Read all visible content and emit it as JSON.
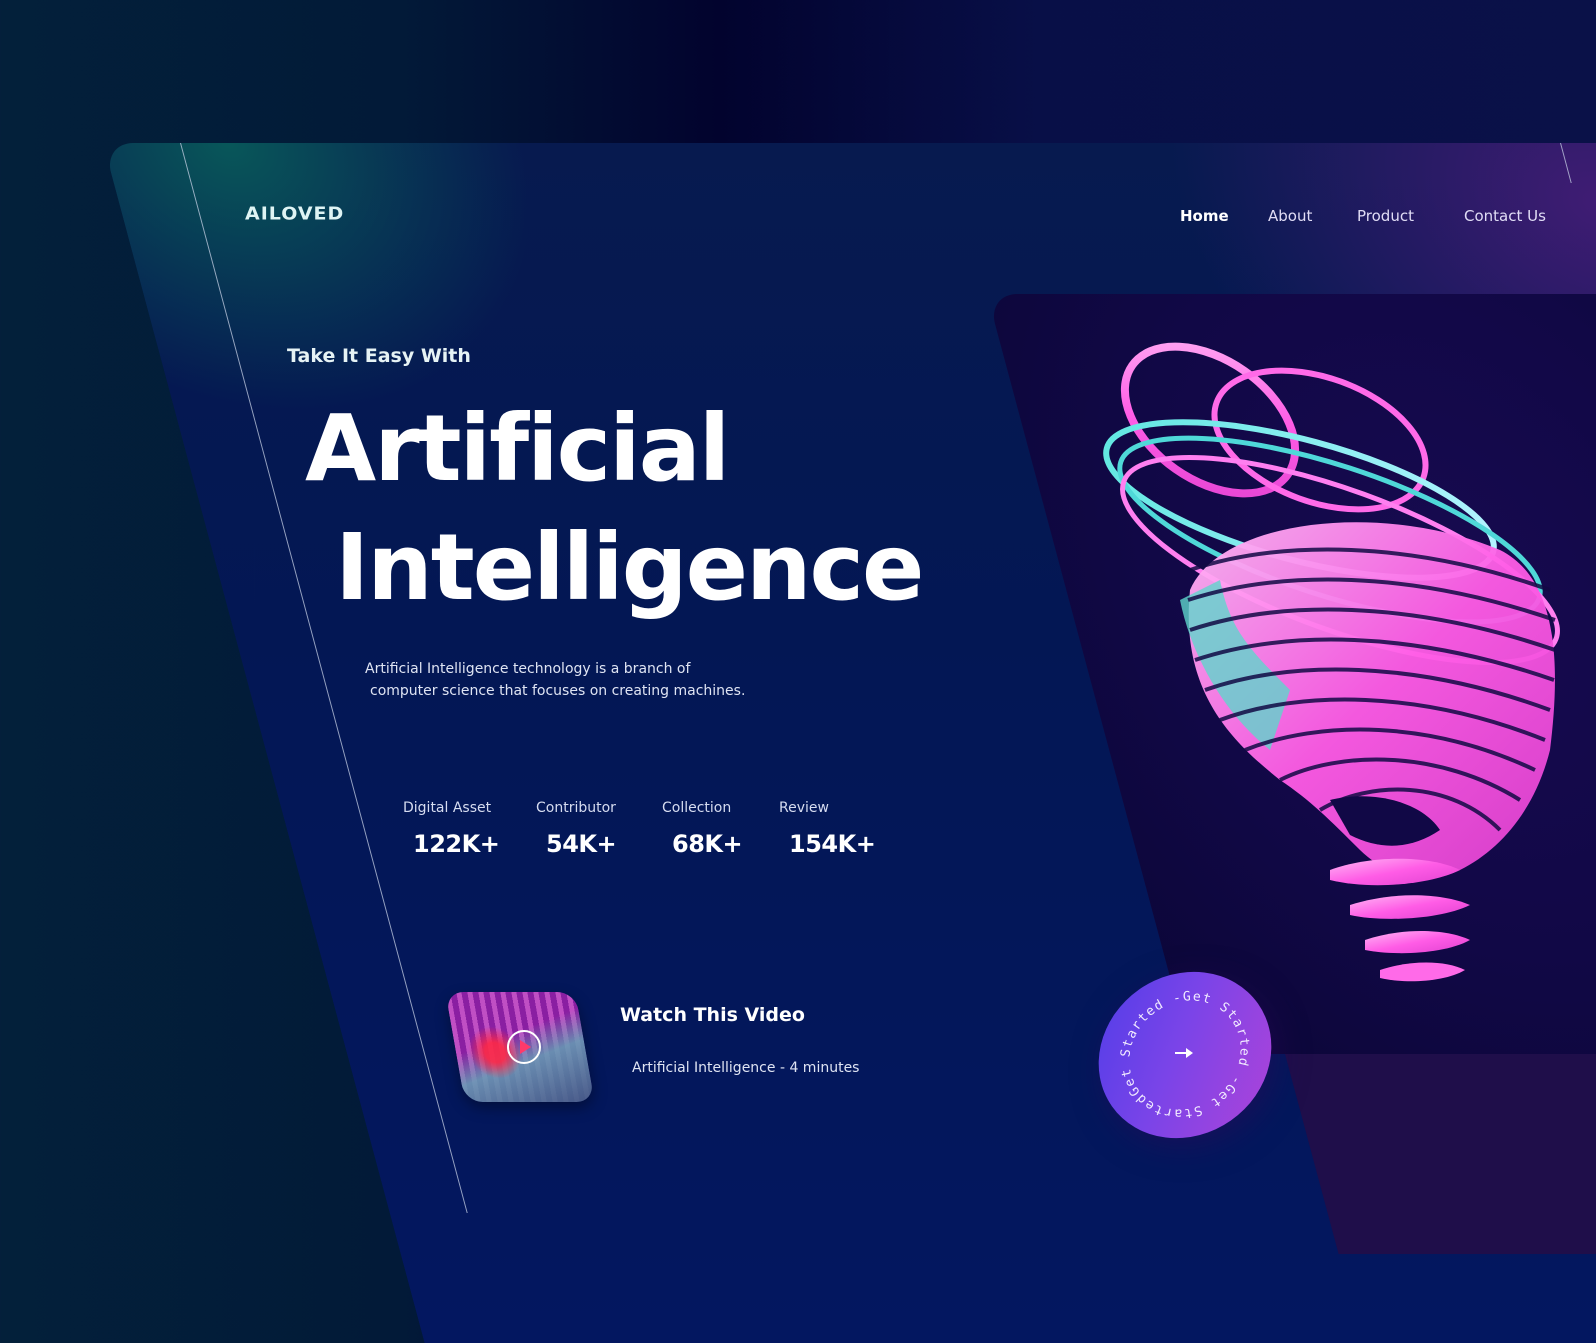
{
  "brand": {
    "logo": "AILOVED"
  },
  "nav": {
    "items": [
      {
        "label": "Home",
        "active": true
      },
      {
        "label": "About",
        "active": false
      },
      {
        "label": "Product",
        "active": false
      },
      {
        "label": "Contact Us",
        "active": false
      }
    ]
  },
  "hero": {
    "tagline": "Take It Easy With",
    "title_line1": "Artificial",
    "title_line2": "Intelligence",
    "description_line1": "Artificial Intelligence technology is a branch of",
    "description_line2": "computer science that focuses on creating machines."
  },
  "stats": [
    {
      "label": "Digital Asset",
      "value": "122K+"
    },
    {
      "label": "Contributor",
      "value": "54K+"
    },
    {
      "label": "Collection",
      "value": "68K+"
    },
    {
      "label": "Review",
      "value": "154K+"
    }
  ],
  "video": {
    "title": "Watch This Video",
    "subtitle": "Artificial Intelligence - 4 minutes",
    "thumbnail_icon": "play-icon"
  },
  "cta": {
    "circular_text": "Get Started -Get Started -Get Started - ",
    "icon": "arrow-right-icon"
  },
  "colors": {
    "background_dark": "#02032e",
    "teal_glow": "#085a5a",
    "purple_glow": "#461c78",
    "card_blue": "#031760",
    "cta_start": "#4f3de8",
    "cta_end": "#b143d8",
    "art_pink": "#ff5ce6",
    "art_cyan": "#5fe6e0"
  }
}
